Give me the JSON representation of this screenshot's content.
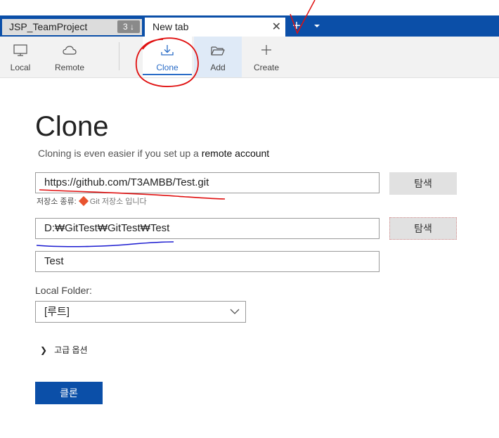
{
  "tabs": [
    {
      "label": "JSP_TeamProject",
      "badge": "3 ↓"
    },
    {
      "label": "New tab",
      "close": "✕"
    }
  ],
  "tab_actions": {
    "new_tab": "+",
    "dropdown": "▾"
  },
  "toolbar": {
    "local": "Local",
    "remote": "Remote",
    "clone": "Clone",
    "add": "Add",
    "create": "Create"
  },
  "main": {
    "title": "Clone",
    "subtitle_prefix": "Cloning is even easier if you set up a ",
    "subtitle_link": "remote account",
    "url_value": "https://github.com/T3AMBB/Test.git",
    "browse_label": "탐색",
    "repo_type_label": "저장소 종류:",
    "repo_type_value": "Git 저장소 입니다",
    "path_value": "D:₩GitTest₩GitTest₩Test",
    "name_value": "Test",
    "local_folder_label": "Local Folder:",
    "local_folder_value": "[루트]",
    "advanced_label": "고급 옵션",
    "clone_button": "클론"
  },
  "colors": {
    "accent": "#0b4fa8",
    "clone_active": "#2a6cc7",
    "git_icon": "#e8532f",
    "annotation_red": "#e01010",
    "annotation_blue": "#1a1ad0"
  }
}
